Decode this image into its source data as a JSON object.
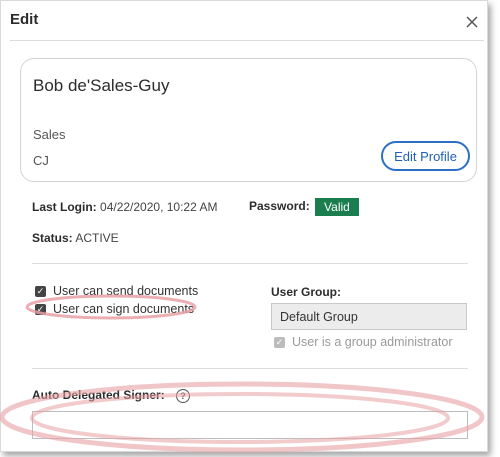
{
  "dialog": {
    "title": "Edit",
    "close_icon": "close-icon"
  },
  "profile": {
    "name": "Bob de'Sales-Guy",
    "department": "Sales",
    "initials": "CJ",
    "edit_button": "Edit Profile"
  },
  "info": {
    "last_login_label": "Last Login:",
    "last_login_value": "04/22/2020, 10:22 AM",
    "password_label": "Password:",
    "password_value": "Valid",
    "status_label": "Status:",
    "status_value": "ACTIVE"
  },
  "permissions": {
    "can_send_label": "User can send documents",
    "can_send_checked": true,
    "can_sign_label": "User can sign documents",
    "can_sign_checked": true
  },
  "user_group": {
    "label": "User Group:",
    "value": "Default Group",
    "admin_label": "User is a group administrator",
    "admin_checked": true
  },
  "delegation": {
    "label": "Auto Delegated Signer:",
    "help_icon": "help-icon",
    "input_value": ""
  },
  "colors": {
    "accent": "#2c6fc5",
    "valid_badge": "#1b7e4f",
    "highlight": "#e8a0a4"
  }
}
